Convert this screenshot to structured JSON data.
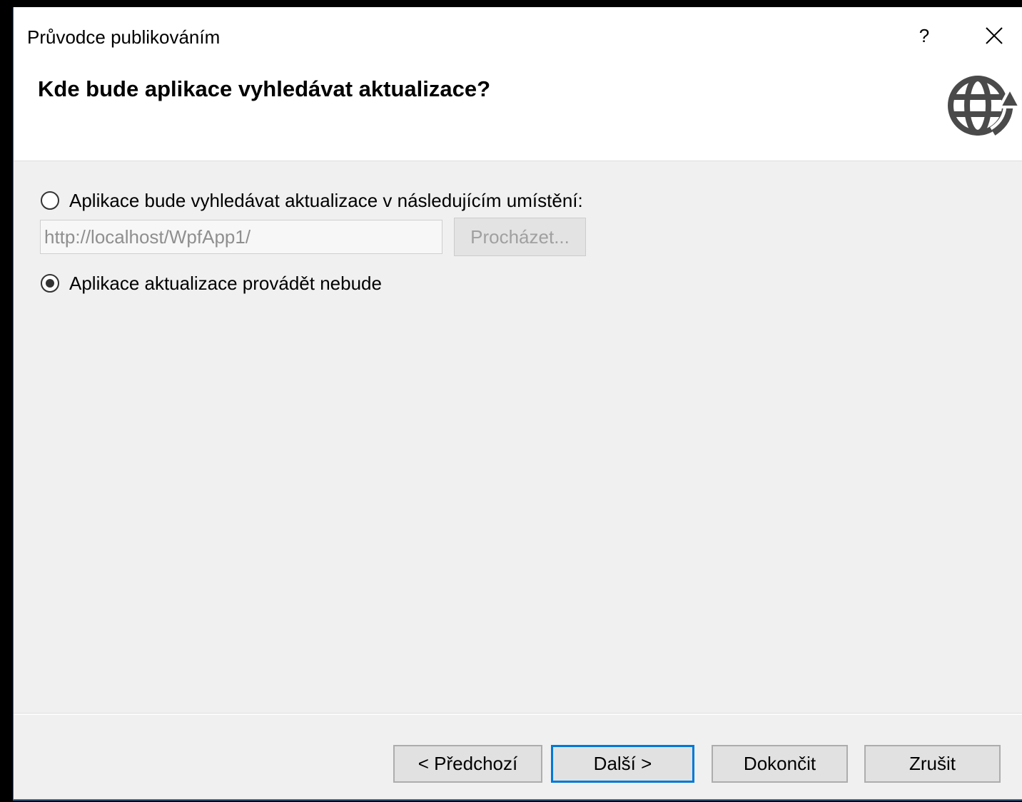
{
  "window": {
    "title": "Průvodce publikováním",
    "help_label": "?",
    "close_icon": "close-icon"
  },
  "header": {
    "heading": "Kde bude aplikace vyhledávat aktualizace?",
    "icon": "globe-upload-icon"
  },
  "update_options": {
    "check_for_updates": {
      "label": "Aplikace bude vyhledávat aktualizace v následujícím umístění:",
      "selected": false
    },
    "update_location": {
      "value": "http://localhost/WpfApp1/",
      "enabled": false
    },
    "browse_button": {
      "label": "Procházet...",
      "enabled": false
    },
    "no_updates": {
      "label": "Aplikace aktualizace provádět nebude",
      "selected": true
    }
  },
  "footer": {
    "buttons": [
      {
        "label": "< Předchozí",
        "is_default": false
      },
      {
        "label": "Další >",
        "is_default": true
      },
      {
        "label": "Dokončit",
        "is_default": false
      },
      {
        "label": "Zrušit",
        "is_default": false
      }
    ]
  },
  "colors": {
    "frame": "#000000",
    "header_bg": "#ffffff",
    "panel_bg": "#f0f0f0",
    "text": "#000000",
    "disabled_text": "#8f8f8f",
    "button_bg": "#e1e1e1",
    "button_border": "#adadad",
    "default_button_border": "#0078d7",
    "icon": "#4a4a4a",
    "window_border": "#2f6aa3"
  }
}
